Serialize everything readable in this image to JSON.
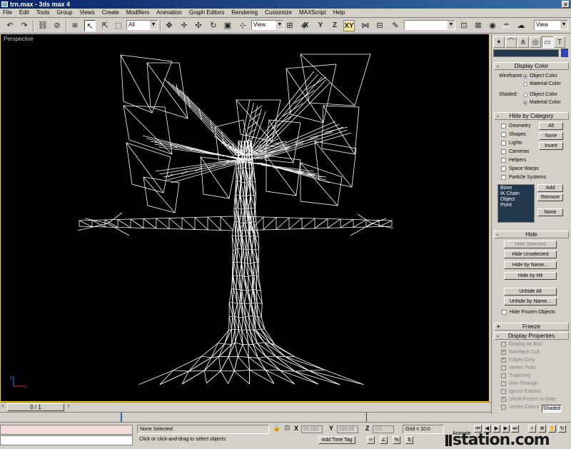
{
  "title_bar": {
    "title": "trn.max - 3ds max 4",
    "close_glyph": "×"
  },
  "menu": [
    "File",
    "Edit",
    "Tools",
    "Group",
    "Views",
    "Create",
    "Modifiers",
    "Animation",
    "Graph Editors",
    "Rendering",
    "Customize",
    "MAXScript",
    "Help"
  ],
  "toolbar": {
    "selection_filter": "All",
    "reference_coord": "View",
    "axis_x": "X",
    "axis_y": "Y",
    "axis_z": "Z",
    "axis_xy": "XY",
    "right_view_combo": "View"
  },
  "viewport": {
    "label": "Perspective",
    "tripod_x": "x",
    "tripod_z": "z"
  },
  "command_panel": {
    "tab_icons": [
      "create-icon",
      "modify-icon",
      "hierarchy-icon",
      "motion-icon",
      "display-icon",
      "utilities-icon"
    ],
    "display_color": {
      "title": "Display Color",
      "wireframe_label": "Wireframe:",
      "shaded_label": "Shaded:",
      "object_color": "Object Color",
      "material_color": "Material Color",
      "wireframe_selected": "Object Color",
      "shaded_selected": "Material Color"
    },
    "hide_by_category": {
      "title": "Hide by Category",
      "categories": [
        "Geometry",
        "Shapes",
        "Lights",
        "Cameras",
        "Helpers",
        "Space Warps",
        "Particle Systems"
      ],
      "all_btn": "All",
      "none_btn": "None",
      "invert_btn": "Invert",
      "list_items": [
        "Bone",
        "IK Chain Object",
        "Point"
      ],
      "add_btn": "Add",
      "remove_btn": "Remove",
      "none_btn2": "None"
    },
    "hide": {
      "title": "Hide",
      "hide_selected": "Hide Selected",
      "hide_unselected": "Hide Unselected",
      "hide_by_name": "Hide by Name...",
      "hide_by_hit": "Hide by Hit",
      "unhide_all": "Unhide All",
      "unhide_by_name": "Unhide by Name...",
      "hide_frozen": "Hide Frozen Objects"
    },
    "freeze": {
      "title": "Freeze"
    },
    "display_properties": {
      "title": "Display Properties",
      "items": [
        "Display as Box",
        "Backface Cull",
        "Edges Only",
        "Vertex Ticks",
        "Trajectory",
        "See-Through",
        "Ignore Extents",
        "Show Frozen in Gray",
        "Vertex Colors"
      ],
      "checked": [
        false,
        true,
        true,
        false,
        false,
        false,
        false,
        true,
        false
      ],
      "shaded_btn": "Shaded"
    },
    "pm_minus": "-",
    "pm_plus": "+"
  },
  "timeline": {
    "frame": "0 / 1",
    "prev": "<",
    "next": ">"
  },
  "status": {
    "selection": "None Selected",
    "prompt": "Click or click-and-drag to select objects",
    "x_label": "X",
    "y_label": "Y",
    "z_label": "Z",
    "x_value": "35.181",
    "y_value": "193.06",
    "z_value": "0.0",
    "grid": "Grid = 10.0",
    "add_time_tag": "Add Time Tag",
    "animate": "Animate"
  },
  "watermark": "station.com"
}
